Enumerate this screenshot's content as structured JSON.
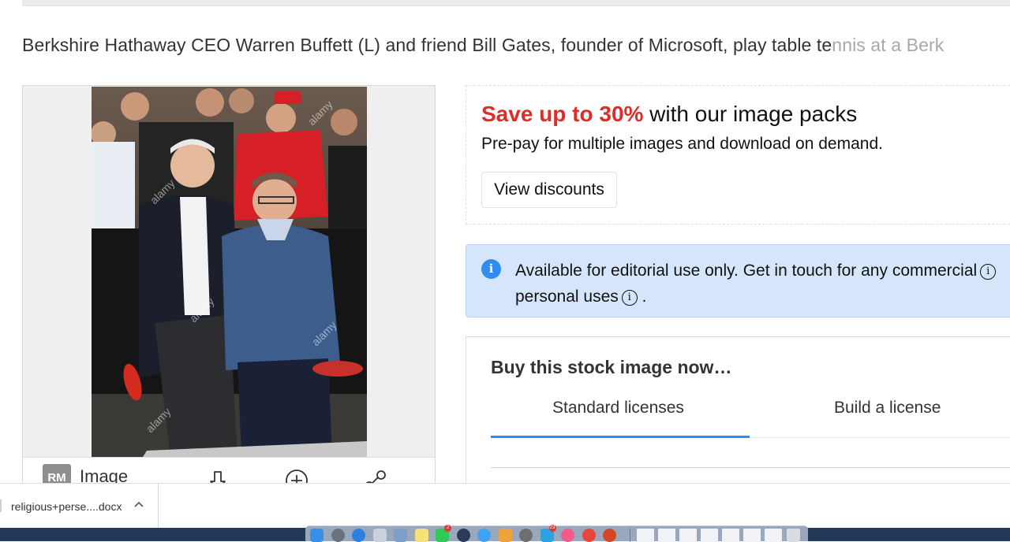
{
  "caption": {
    "text_main": "Berkshire Hathaway CEO Warren Buffett (L) and friend Bill Gates, founder of Microsoft, play table te",
    "text_faded": "nnis at a Berk"
  },
  "image_panel": {
    "photo_alt": "Warren Buffett and Bill Gates playing table tennis",
    "watermark": "alamy",
    "badge": "RM",
    "label": "Image",
    "icons": [
      "download-icon",
      "add-to-lightbox-icon",
      "share-icon"
    ]
  },
  "promo": {
    "highlight": "Save up to 30%",
    "title_rest": " with our image packs",
    "subtitle": "Pre-pay for multiple images and download on demand.",
    "button_label": "View discounts",
    "accent_color": "#e02b27"
  },
  "notice": {
    "icon": "i",
    "line1": "Available for editorial use only. Get in touch for any commercial",
    "line2": "personal uses",
    "line2_end": ".",
    "info_glyph": "i",
    "bg_color": "#d6e6fa"
  },
  "buy": {
    "title": "Buy this stock image now…",
    "tabs": [
      {
        "label": "Standard licenses",
        "active": true
      },
      {
        "label": "Build a license",
        "active": false
      }
    ],
    "accent_color": "#2f8cf0"
  },
  "download_bar": {
    "filename": "religious+perse....docx",
    "chevron": "^"
  },
  "dock": {
    "apps": [
      {
        "name": "finder",
        "color": "#3a8ee6"
      },
      {
        "name": "launchpad",
        "color": "#6b7280"
      },
      {
        "name": "safari",
        "color": "#2d7fe0"
      },
      {
        "name": "help",
        "color": "#c9d1dc"
      },
      {
        "name": "preview",
        "color": "#7f9fc8"
      },
      {
        "name": "notes",
        "color": "#f7e27a"
      },
      {
        "name": "facetime",
        "color": "#34c759",
        "badge": "2"
      },
      {
        "name": "quicktime",
        "color": "#2b3b55"
      },
      {
        "name": "messages",
        "color": "#3fa2f7"
      },
      {
        "name": "photo-booth",
        "color": "#f0a23a"
      },
      {
        "name": "system-preferences",
        "color": "#6e6e73"
      },
      {
        "name": "telegram",
        "color": "#2aa3e0",
        "badge": "23"
      },
      {
        "name": "itunes",
        "color": "#f25b8a"
      },
      {
        "name": "chrome",
        "color": "#e8453c"
      },
      {
        "name": "powerpoint",
        "color": "#d24726"
      }
    ],
    "docs_count": 7,
    "trash": "trash"
  }
}
